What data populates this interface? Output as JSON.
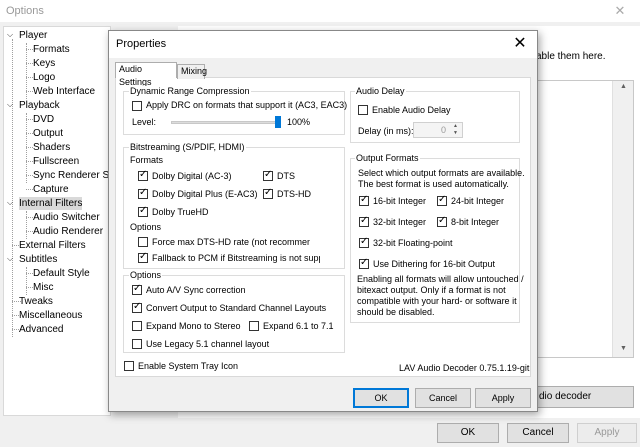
{
  "background_window": {
    "title": "Options",
    "close_glyph": "✕",
    "enable_hint": "able them here.",
    "audio_decoder_button": "dio decoder",
    "ok": "OK",
    "cancel": "Cancel",
    "apply": "Apply",
    "tree": {
      "player": "Player",
      "formats": "Formats",
      "keys": "Keys",
      "logo": "Logo",
      "web_interface": "Web Interface",
      "playback": "Playback",
      "dvd": "DVD",
      "output": "Output",
      "shaders": "Shaders",
      "fullscreen": "Fullscreen",
      "sync_renderer": "Sync Renderer Set",
      "capture": "Capture",
      "internal_filters": "Internal Filters",
      "audio_switcher": "Audio Switcher",
      "audio_renderer": "Audio Renderer",
      "external_filters": "External Filters",
      "subtitles": "Subtitles",
      "default_style": "Default Style",
      "misc": "Misc",
      "tweaks": "Tweaks",
      "miscellaneous": "Miscellaneous",
      "advanced": "Advanced"
    }
  },
  "dialog": {
    "title": "Properties",
    "close_glyph": "✕",
    "tabs": {
      "audio_settings": "Audio Settings",
      "mixing": "Mixing"
    },
    "drc": {
      "group_label": "Dynamic Range Compression",
      "apply_drc": "Apply DRC on formats that support it (AC3, EAC3)",
      "apply_drc_checked": false,
      "level_label": "Level:",
      "level_value": "100%",
      "level_fraction": 1.0
    },
    "bitstreaming": {
      "group_label": "Bitstreaming (S/PDIF, HDMI)",
      "formats_label": "Formats",
      "ac3": "Dolby Digital (AC-3)",
      "ac3_checked": true,
      "dts": "DTS",
      "dts_checked": true,
      "eac3": "Dolby Digital Plus (E-AC3)",
      "eac3_checked": true,
      "dtshd": "DTS-HD",
      "dtshd_checked": true,
      "truehd": "Dolby TrueHD",
      "truehd_checked": true,
      "options_label": "Options",
      "force_dtshd": "Force max DTS-HD rate (not recommende",
      "force_dtshd_checked": false,
      "fallback_pcm": "Fallback to PCM if Bitstreaming is not supporte",
      "fallback_pcm_checked": true
    },
    "options": {
      "group_label": "Options",
      "av_sync": "Auto A/V Sync correction",
      "av_sync_checked": true,
      "convert_layouts": "Convert Output to Standard Channel Layouts",
      "convert_layouts_checked": true,
      "expand_mono": "Expand Mono to Stereo",
      "expand_mono_checked": false,
      "expand_61": "Expand 6.1 to 7.1",
      "expand_61_checked": false,
      "legacy_51": "Use Legacy 5.1 channel layout",
      "legacy_51_checked": false
    },
    "tray_icon": "Enable System Tray Icon",
    "tray_icon_checked": false,
    "audio_delay": {
      "group_label": "Audio Delay",
      "enable": "Enable Audio Delay",
      "enable_checked": false,
      "delay_label": "Delay (in ms):",
      "delay_value": "0"
    },
    "output_formats": {
      "group_label": "Output Formats",
      "desc_line1": "Select which output formats are available.",
      "desc_line2": "The best format is used automatically.",
      "int16": "16-bit Integer",
      "int16_checked": true,
      "int24": "24-bit Integer",
      "int24_checked": true,
      "int32": "32-bit Integer",
      "int32_checked": true,
      "int8": "8-bit Integer",
      "int8_checked": true,
      "float32": "32-bit Floating-point",
      "float32_checked": true,
      "dither": "Use Dithering for 16-bit Output",
      "dither_checked": true,
      "note_line1": "Enabling all formats will allow untouched /",
      "note_line2": "bitexact output. Only if a format is not",
      "note_line3": "compatible with your hard- or software it",
      "note_line4": "should be disabled."
    },
    "version": "LAV Audio Decoder 0.75.1.19-git",
    "ok": "OK",
    "cancel": "Cancel",
    "apply": "Apply"
  }
}
